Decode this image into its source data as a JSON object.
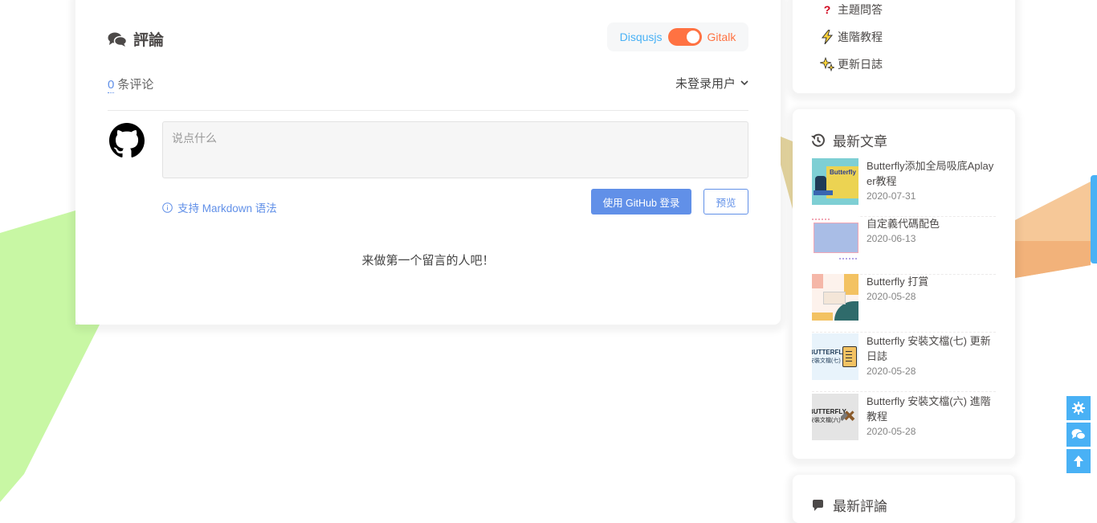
{
  "comments": {
    "heading": "評論",
    "switch": {
      "left": "Disqusjs",
      "right": "Gitalk"
    },
    "count": "0",
    "count_label": "条评论",
    "login_user": "未登录用户",
    "placeholder": "说点什么",
    "markdown_tip": "支持 Markdown 语法",
    "github_login": "使用 GitHub 登录",
    "preview": "预览",
    "empty": "来做第一个留言的人吧！"
  },
  "sidebar": {
    "links": [
      {
        "label": "主題問答",
        "icon": "question-icon"
      },
      {
        "label": "進階教程",
        "icon": "lightning-icon"
      },
      {
        "label": "更新日誌",
        "icon": "sparkles-icon"
      }
    ],
    "recent": {
      "heading": "最新文章",
      "posts": [
        {
          "title": "Butterfly添加全局吸底Aplayer教程",
          "date": "2020-07-31"
        },
        {
          "title": "自定義代碼配色",
          "date": "2020-06-13"
        },
        {
          "title": "Butterfly 打賞",
          "date": "2020-05-28"
        },
        {
          "title": "Butterfly 安裝文檔(七) 更新日誌",
          "date": "2020-05-28"
        },
        {
          "title": "Butterfly 安裝文檔(六) 進階教程",
          "date": "2020-05-28"
        }
      ]
    },
    "newest_comments_heading": "最新評論"
  },
  "thumb_text": {
    "t1": "Butterfly",
    "t4": "BUTTERFLY",
    "t4b": "安裝文檔(七)",
    "t5": "BUTTERFLY",
    "t5b": "安裝文檔(六)"
  },
  "colors": {
    "accent": "#49b1f5",
    "gitalk": "#ff7242",
    "link_blue": "#6190e8"
  }
}
